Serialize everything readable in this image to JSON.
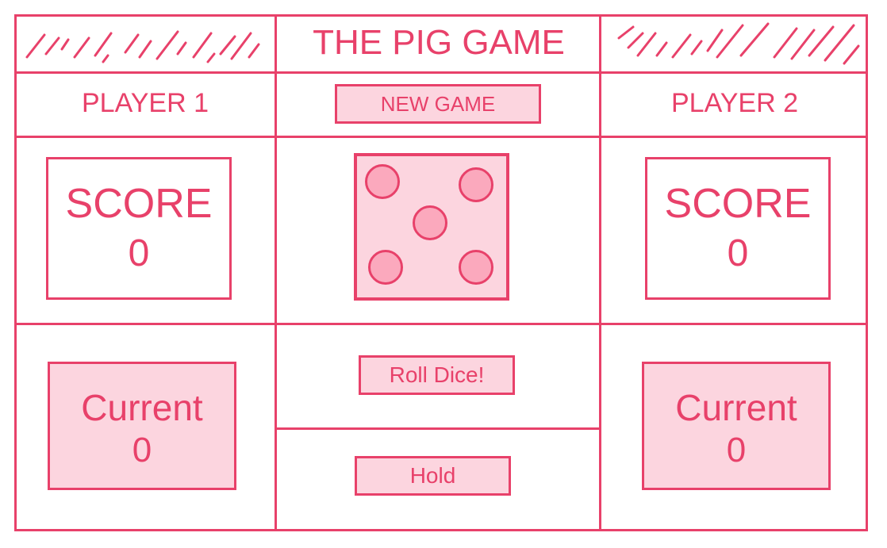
{
  "header": {
    "title": "THE PIG GAME",
    "new_game_label": "NEW GAME"
  },
  "players": [
    {
      "label": "PLAYER 1",
      "score_label": "SCORE",
      "score": "0",
      "current_label": "Current",
      "current": "0"
    },
    {
      "label": "PLAYER 2",
      "score_label": "SCORE",
      "score": "0",
      "current_label": "Current",
      "current": "0"
    }
  ],
  "dice": {
    "icon": "dice-five-icon",
    "value": 5
  },
  "controls": {
    "roll_label": "Roll Dice!",
    "hold_label": "Hold"
  },
  "colors": {
    "accent": "#e8416a",
    "fill": "#fcd5df",
    "pip": "#fba9bd",
    "background": "#ffffff"
  }
}
